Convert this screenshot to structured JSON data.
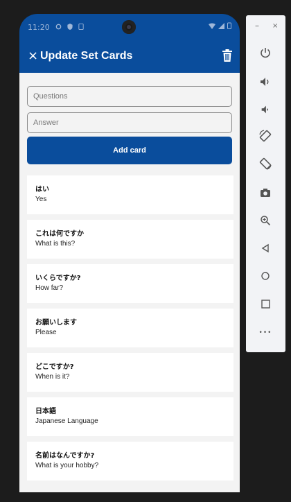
{
  "status_bar": {
    "time": "11:20"
  },
  "app_bar": {
    "title": "Update Set Cards",
    "close_glyph": "×"
  },
  "form": {
    "question_placeholder": "Questions",
    "answer_placeholder": "Answer",
    "add_button_label": "Add card"
  },
  "cards": [
    {
      "question": "はい",
      "answer": "Yes"
    },
    {
      "question": "これは何ですか",
      "answer": "What is this?"
    },
    {
      "question": "いくらですか?",
      "answer": "How far?"
    },
    {
      "question": "お願いします",
      "answer": "Please"
    },
    {
      "question": "どこですか?",
      "answer": "When is it?"
    },
    {
      "question": "日本語",
      "answer": "Japanese Language"
    },
    {
      "question": "名前はなんですか?",
      "answer": "What is your hobby?"
    }
  ],
  "emulator_toolbar": {
    "minimize_glyph": "–",
    "close_glyph": "×",
    "more_glyph": "•••",
    "buttons": [
      "power-icon",
      "volume-up-icon",
      "volume-down-icon",
      "rotate-left-icon",
      "rotate-right-icon",
      "camera-icon",
      "zoom-icon",
      "back-icon",
      "home-icon",
      "overview-icon",
      "more-icon"
    ]
  },
  "colors": {
    "primary": "#0a4d9c",
    "background": "#f3f3f3",
    "card": "#ffffff",
    "emulator_bg": "#1c1c1c"
  }
}
